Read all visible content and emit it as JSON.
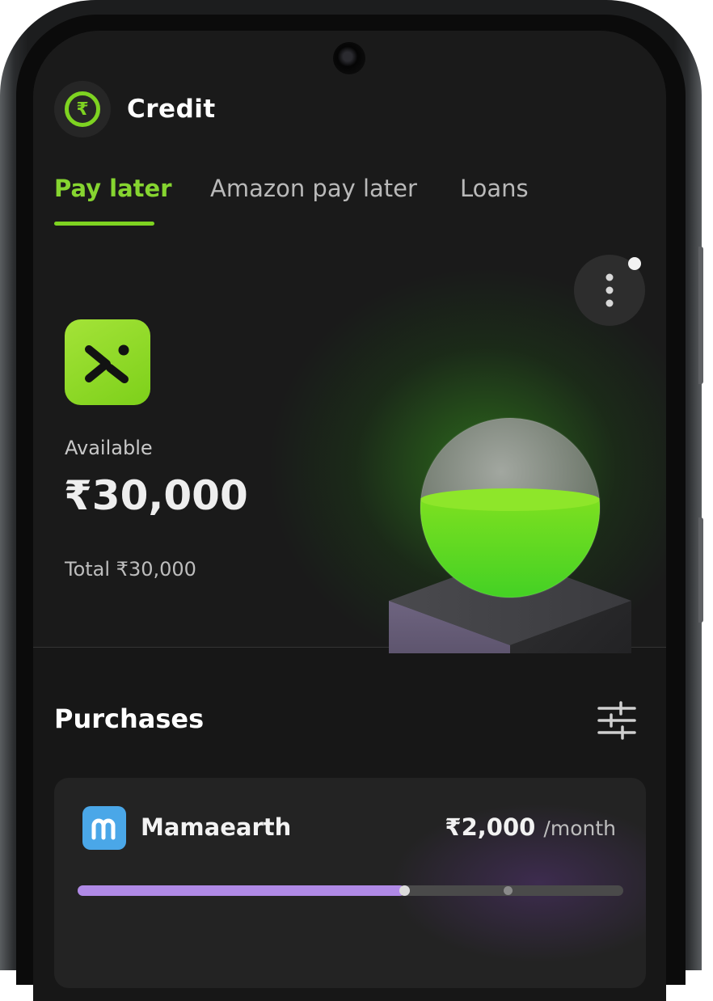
{
  "app": {
    "title": "Credit",
    "logo_icon": "rupee-circle-icon",
    "logo_glyph": "₹",
    "accent_color": "#7ed321"
  },
  "tabs": [
    {
      "label": "Pay later",
      "active": true
    },
    {
      "label": "Amazon pay later",
      "active": false
    },
    {
      "label": "Loans",
      "active": false
    }
  ],
  "credit": {
    "provider_icon": "brand-x-logo-icon",
    "available_label": "Available",
    "available_amount": "₹30,000",
    "total_label": "Total ₹30,000"
  },
  "menu": {
    "icon": "more-vertical-icon",
    "has_notification": true
  },
  "purchases": {
    "title": "Purchases",
    "filter_icon": "sliders-icon",
    "items": [
      {
        "merchant": "Mamaearth",
        "icon": "mamaearth-logo-icon",
        "amount": "₹2,000",
        "unit": "/month",
        "progress": 0.6,
        "progress_marker": 0.79,
        "progress_color": "#b08ae6"
      }
    ]
  }
}
